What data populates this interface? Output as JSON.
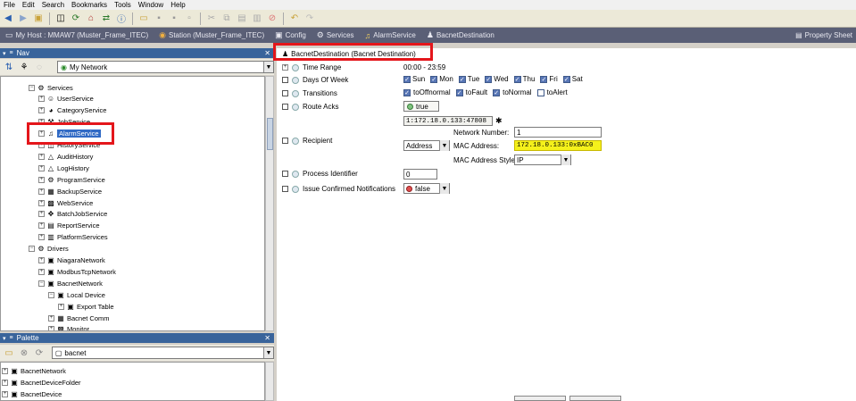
{
  "menu": [
    "File",
    "Edit",
    "Search",
    "Bookmarks",
    "Tools",
    "Window",
    "Help"
  ],
  "locator": {
    "items": [
      {
        "label": "My Host : MMAW7 (Muster_Frame_ITEC)",
        "icon": "host-icon"
      },
      {
        "label": "Station (Muster_Frame_ITEC)",
        "icon": "station-icon"
      },
      {
        "label": "Config",
        "icon": "config-icon"
      },
      {
        "label": "Services",
        "icon": "services-icon"
      },
      {
        "label": "AlarmService",
        "icon": "bell-icon"
      },
      {
        "label": "BacnetDestination",
        "icon": "bacnet-destination-icon"
      }
    ],
    "view": "Property Sheet"
  },
  "nav": {
    "title": "Nav",
    "selector": "My Network",
    "tree": [
      {
        "label": "Services",
        "indent": 1,
        "expanded": true,
        "icon": "services-icon"
      },
      {
        "label": "UserService",
        "indent": 2,
        "icon": "user-icon"
      },
      {
        "label": "CategoryService",
        "indent": 2,
        "icon": "category-icon"
      },
      {
        "label": "JobService",
        "indent": 2,
        "icon": "job-icon"
      },
      {
        "label": "AlarmService",
        "indent": 2,
        "icon": "bell-icon",
        "selected": true
      },
      {
        "label": "HistoryService",
        "indent": 2,
        "icon": "history-icon"
      },
      {
        "label": "AuditHistory",
        "indent": 2,
        "icon": "audit-icon"
      },
      {
        "label": "LogHistory",
        "indent": 2,
        "icon": "log-icon"
      },
      {
        "label": "ProgramService",
        "indent": 2,
        "icon": "program-icon"
      },
      {
        "label": "BackupService",
        "indent": 2,
        "icon": "backup-icon"
      },
      {
        "label": "WebService",
        "indent": 2,
        "icon": "web-icon"
      },
      {
        "label": "BatchJobService",
        "indent": 2,
        "icon": "batch-icon"
      },
      {
        "label": "ReportService",
        "indent": 2,
        "icon": "report-icon"
      },
      {
        "label": "PlatformServices",
        "indent": 2,
        "icon": "platform-icon"
      },
      {
        "label": "Drivers",
        "indent": 1,
        "expanded": true,
        "icon": "drivers-icon"
      },
      {
        "label": "NiagaraNetwork",
        "indent": 2,
        "icon": "network-icon"
      },
      {
        "label": "ModbusTcpNetwork",
        "indent": 2,
        "icon": "network-icon"
      },
      {
        "label": "BacnetNetwork",
        "indent": 2,
        "expanded": true,
        "icon": "network-icon"
      },
      {
        "label": "Local Device",
        "indent": 3,
        "expanded": true,
        "icon": "device-icon"
      },
      {
        "label": "Export Table",
        "indent": 4,
        "icon": "table-icon"
      },
      {
        "label": "Bacnet Comm",
        "indent": 3,
        "icon": "comm-icon"
      },
      {
        "label": "Monitor",
        "indent": 3,
        "icon": "monitor-icon"
      }
    ]
  },
  "palette": {
    "title": "Palette",
    "search": "bacnet",
    "items": [
      "BacnetNetwork",
      "BacnetDeviceFolder",
      "BacnetDevice"
    ]
  },
  "sheet": {
    "title": "BacnetDestination  (Bacnet Destination)",
    "time_range": {
      "label": "Time Range",
      "value": "00:00 - 23:59"
    },
    "days_of_week": {
      "label": "Days Of Week",
      "days": [
        {
          "label": "Sun",
          "checked": true
        },
        {
          "label": "Mon",
          "checked": true
        },
        {
          "label": "Tue",
          "checked": true
        },
        {
          "label": "Wed",
          "checked": true
        },
        {
          "label": "Thu",
          "checked": true
        },
        {
          "label": "Fri",
          "checked": true
        },
        {
          "label": "Sat",
          "checked": true
        }
      ]
    },
    "transitions": {
      "label": "Transitions",
      "items": [
        {
          "label": "toOffnormal",
          "checked": true
        },
        {
          "label": "toFault",
          "checked": true
        },
        {
          "label": "toNormal",
          "checked": true
        },
        {
          "label": "toAlert",
          "checked": false
        }
      ]
    },
    "route_acks": {
      "label": "Route Acks",
      "value": "true"
    },
    "recipient": {
      "label": "Recipient",
      "address_display": "1:172.18.0.133:47808",
      "address_type": "Address",
      "network_number_label": "Network Number:",
      "network_number": "1",
      "mac_address_label": "MAC Address:",
      "mac_address": "172.18.0.133:0xBAC0",
      "mac_style_label": "MAC Address Style:",
      "mac_style": "IP"
    },
    "process_identifier": {
      "label": "Process Identifier",
      "value": "0"
    },
    "issue_confirmed": {
      "label": "Issue Confirmed Notifications",
      "value": "false"
    }
  },
  "colors": {
    "highlight_box": "#e4161b",
    "mac_highlight": "#f5f11b",
    "selection": "#316ac5"
  }
}
